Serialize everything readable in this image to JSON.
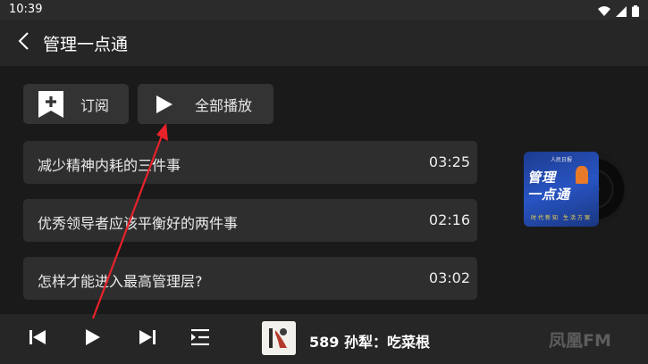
{
  "status_bar": {
    "time": "10:39"
  },
  "app_bar": {
    "title": "管理一点通"
  },
  "actions": {
    "subscribe_label": "订阅",
    "play_all_label": "全部播放"
  },
  "tracks": [
    {
      "title": "减少精神内耗的三件事",
      "duration": "03:25"
    },
    {
      "title": "优秀领导者应该平衡好的两件事",
      "duration": "02:16"
    },
    {
      "title": "怎样才能进入最高管理层?",
      "duration": "03:02"
    }
  ],
  "album_cover": {
    "top_text": "人民日报",
    "main_line1": "管理",
    "main_line2": "一点通",
    "bottom_text": "时代新知 生活方案"
  },
  "player": {
    "now_playing": "589 孙犁：吃菜根"
  },
  "brand": "凤凰FM",
  "colors": {
    "background": "#1a1a1a",
    "card": "#2e2e2e",
    "annotation_arrow": "#e8222a"
  }
}
